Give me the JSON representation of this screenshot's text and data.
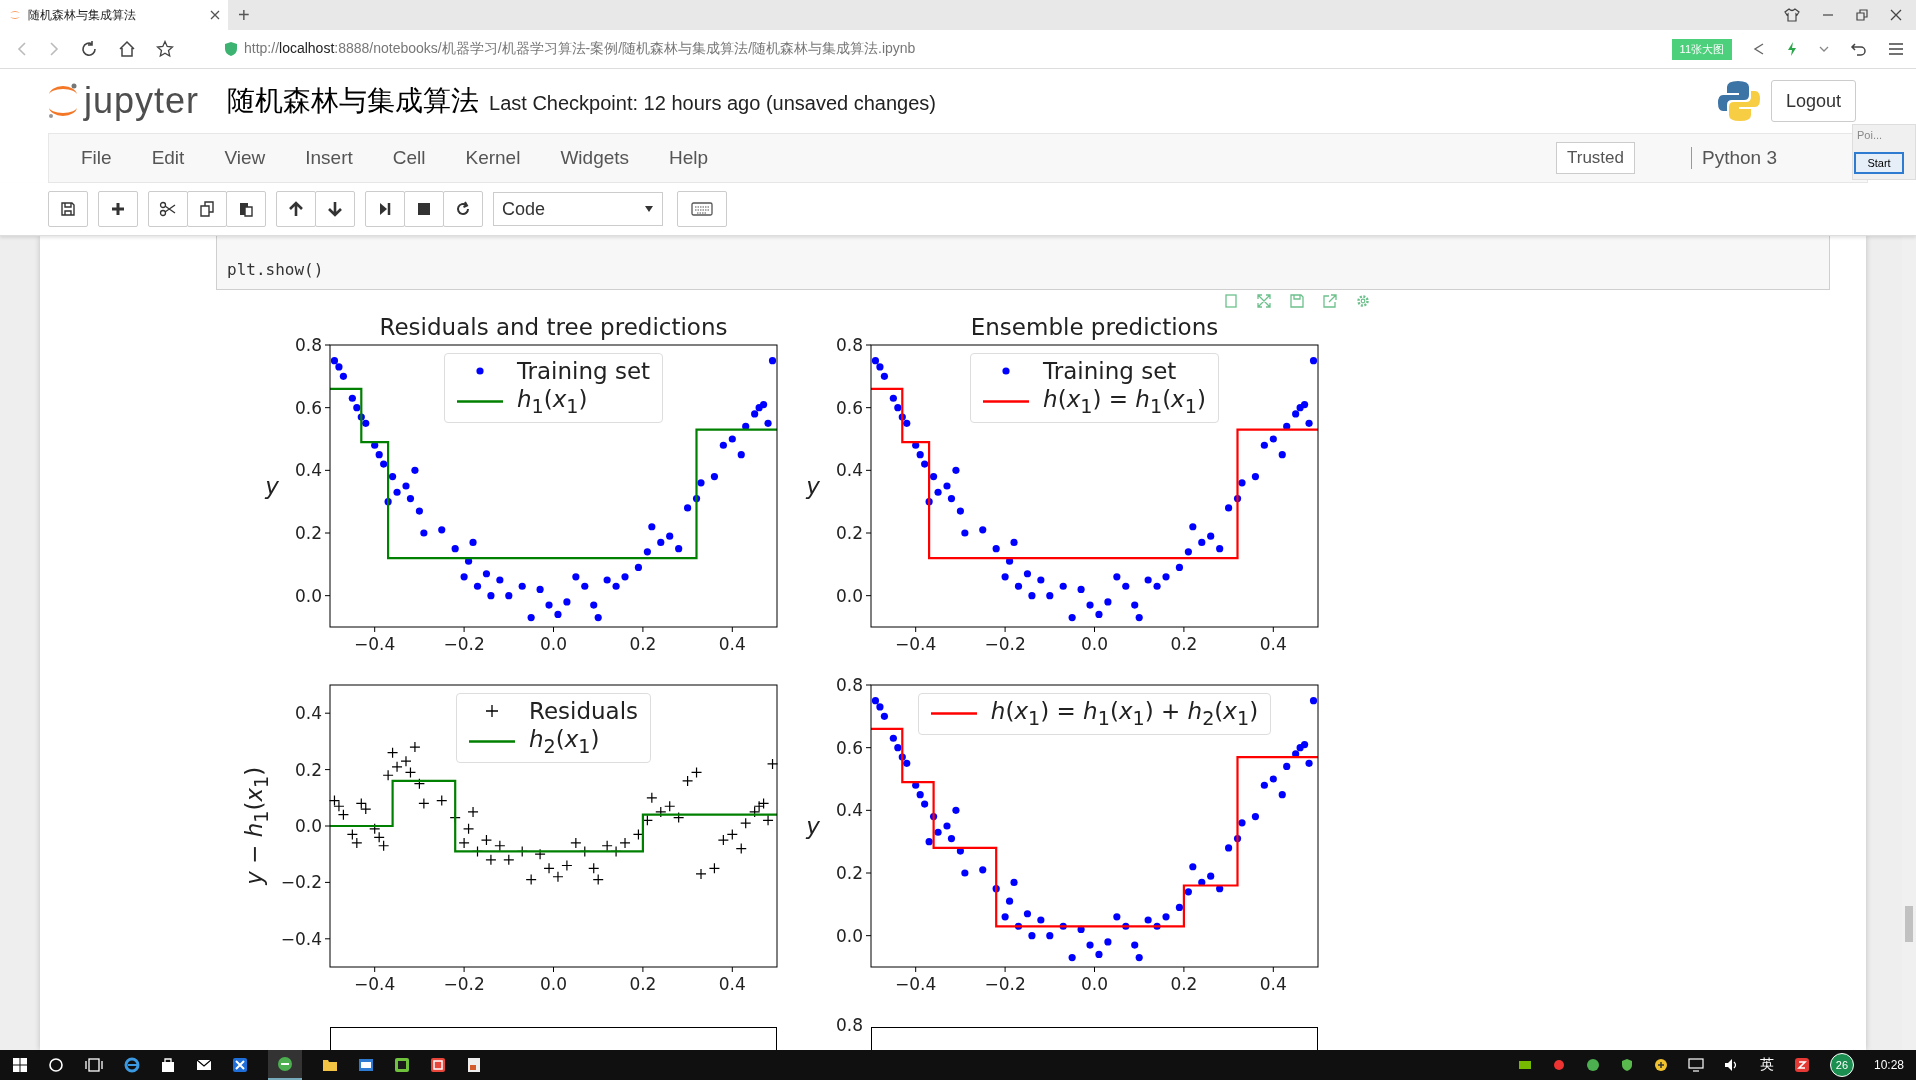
{
  "browser": {
    "tab_title": "随机森林与集成算法",
    "new_tab": "+",
    "url": "http://**localhost**:8888/notebooks/机器学习/机器学习算法-案例/随机森林与集成算法/随机森林与集成算法.ipynb",
    "badge": "11张大图"
  },
  "notebook": {
    "logo_text": "jupyter",
    "title": "随机森林与集成算法",
    "checkpoint": "Last Checkpoint: 12 hours ago (unsaved changes)",
    "logout": "Logout"
  },
  "menu": [
    "File",
    "Edit",
    "View",
    "Insert",
    "Cell",
    "Kernel",
    "Widgets",
    "Help"
  ],
  "trusted": "Trusted",
  "kernel": "Python 3",
  "toolbar": {
    "cell_type": "Code"
  },
  "popup": {
    "title": "Poi...",
    "button": "Start"
  },
  "cell": {
    "code": "plt.show()"
  },
  "charts": [
    {
      "chart_data": {
        "type": "scatter",
        "title": "Residuals and tree predictions",
        "ylabel": "*y*",
        "legend": true,
        "xlim": [
          -0.5,
          0.5
        ],
        "ylim": [
          -0.1,
          0.8
        ],
        "xticks": [
          {
            "value": -0.4,
            "label": "−0.4"
          },
          {
            "value": -0.2,
            "label": "−0.2"
          },
          {
            "value": 0,
            "label": "0.0"
          },
          {
            "value": 0.2,
            "label": "0.2"
          },
          {
            "value": 0.4,
            "label": "0.4"
          }
        ],
        "yticks": [
          {
            "value": 0.8,
            "label": "0.8"
          },
          {
            "value": 0.6,
            "label": "0.6"
          },
          {
            "value": 0.4,
            "label": "0.4"
          },
          {
            "value": 0.2,
            "label": "0.2"
          },
          {
            "value": 0,
            "label": "0.0"
          }
        ],
        "series": [
          {
            "name": "Training set",
            "type": "scatter",
            "marker": "circle",
            "color": "#0000ff",
            "x": [
              -0.49,
              -0.48,
              -0.47,
              -0.45,
              -0.44,
              -0.43,
              -0.42,
              -0.4,
              -0.39,
              -0.38,
              -0.37,
              -0.36,
              -0.35,
              -0.33,
              -0.32,
              -0.31,
              -0.3,
              -0.29,
              -0.25,
              -0.22,
              -0.2,
              -0.19,
              -0.18,
              -0.17,
              -0.15,
              -0.14,
              -0.12,
              -0.1,
              -0.07,
              -0.05,
              -0.03,
              -0.01,
              0.01,
              0.03,
              0.05,
              0.07,
              0.09,
              0.1,
              0.12,
              0.14,
              0.16,
              0.19,
              0.21,
              0.22,
              0.24,
              0.26,
              0.28,
              0.3,
              0.32,
              0.33,
              0.36,
              0.38,
              0.4,
              0.42,
              0.43,
              0.45,
              0.46,
              0.47,
              0.48,
              0.49
            ],
            "values": [
              0.75,
              0.73,
              0.7,
              0.63,
              0.6,
              0.57,
              0.55,
              0.48,
              0.45,
              0.42,
              0.3,
              0.38,
              0.33,
              0.35,
              0.31,
              0.4,
              0.27,
              0.2,
              0.21,
              0.15,
              0.06,
              0.11,
              0.17,
              0.03,
              0.07,
              0.0,
              0.05,
              0.0,
              0.03,
              -0.07,
              0.02,
              -0.03,
              -0.06,
              -0.02,
              0.06,
              0.03,
              -0.03,
              -0.07,
              0.05,
              0.03,
              0.06,
              0.09,
              0.14,
              0.22,
              0.17,
              0.19,
              0.15,
              0.28,
              0.31,
              0.36,
              0.38,
              0.48,
              0.5,
              0.45,
              0.54,
              0.58,
              0.6,
              0.61,
              0.55,
              0.75
            ]
          },
          {
            "name": "*h*$_{1}$(*x*$_{1}$)",
            "type": "line",
            "color": "#008000",
            "x": [
              -0.5,
              -0.43,
              -0.43,
              -0.37,
              -0.37,
              0.32,
              0.32,
              0.5
            ],
            "values": [
              0.66,
              0.66,
              0.49,
              0.49,
              0.12,
              0.12,
              0.53,
              0.53
            ]
          }
        ]
      }
    },
    {
      "chart_data": {
        "type": "scatter",
        "title": "Ensemble predictions",
        "ylabel": "*y*",
        "legend": true,
        "xlim": [
          -0.5,
          0.5
        ],
        "ylim": [
          -0.1,
          0.8
        ],
        "xticks": [
          {
            "value": -0.4,
            "label": "−0.4"
          },
          {
            "value": -0.2,
            "label": "−0.2"
          },
          {
            "value": 0,
            "label": "0.0"
          },
          {
            "value": 0.2,
            "label": "0.2"
          },
          {
            "value": 0.4,
            "label": "0.4"
          }
        ],
        "yticks": [
          {
            "value": 0.8,
            "label": "0.8"
          },
          {
            "value": 0.6,
            "label": "0.6"
          },
          {
            "value": 0.4,
            "label": "0.4"
          },
          {
            "value": 0.2,
            "label": "0.2"
          },
          {
            "value": 0,
            "label": "0.0"
          }
        ],
        "series": [
          {
            "name": "Training set",
            "type": "scatter",
            "marker": "circle",
            "color": "#0000ff",
            "x": [
              -0.49,
              -0.48,
              -0.47,
              -0.45,
              -0.44,
              -0.43,
              -0.42,
              -0.4,
              -0.39,
              -0.38,
              -0.37,
              -0.36,
              -0.35,
              -0.33,
              -0.32,
              -0.31,
              -0.3,
              -0.29,
              -0.25,
              -0.22,
              -0.2,
              -0.19,
              -0.18,
              -0.17,
              -0.15,
              -0.14,
              -0.12,
              -0.1,
              -0.07,
              -0.05,
              -0.03,
              -0.01,
              0.01,
              0.03,
              0.05,
              0.07,
              0.09,
              0.1,
              0.12,
              0.14,
              0.16,
              0.19,
              0.21,
              0.22,
              0.24,
              0.26,
              0.28,
              0.3,
              0.32,
              0.33,
              0.36,
              0.38,
              0.4,
              0.42,
              0.43,
              0.45,
              0.46,
              0.47,
              0.48,
              0.49
            ],
            "values": [
              0.75,
              0.73,
              0.7,
              0.63,
              0.6,
              0.57,
              0.55,
              0.48,
              0.45,
              0.42,
              0.3,
              0.38,
              0.33,
              0.35,
              0.31,
              0.4,
              0.27,
              0.2,
              0.21,
              0.15,
              0.06,
              0.11,
              0.17,
              0.03,
              0.07,
              0.0,
              0.05,
              0.0,
              0.03,
              -0.07,
              0.02,
              -0.03,
              -0.06,
              -0.02,
              0.06,
              0.03,
              -0.03,
              -0.07,
              0.05,
              0.03,
              0.06,
              0.09,
              0.14,
              0.22,
              0.17,
              0.19,
              0.15,
              0.28,
              0.31,
              0.36,
              0.38,
              0.48,
              0.5,
              0.45,
              0.54,
              0.58,
              0.6,
              0.61,
              0.55,
              0.75
            ]
          },
          {
            "name": "*h*(*x*$_{1}$) = *h*$_{1}$(*x*$_{1}$)",
            "type": "line",
            "color": "#ff0000",
            "x": [
              -0.5,
              -0.43,
              -0.43,
              -0.37,
              -0.37,
              0.32,
              0.32,
              0.5
            ],
            "values": [
              0.66,
              0.66,
              0.49,
              0.49,
              0.12,
              0.12,
              0.53,
              0.53
            ]
          }
        ]
      }
    },
    {
      "chart_data": {
        "type": "scatter",
        "ylabel": "*y* − *h*$_{1}$(*x*$_{1}$)",
        "legend": true,
        "xlim": [
          -0.5,
          0.5
        ],
        "ylim": [
          -0.5,
          0.5
        ],
        "xticks": [
          {
            "value": -0.4,
            "label": "−0.4"
          },
          {
            "value": -0.2,
            "label": "−0.2"
          },
          {
            "value": 0,
            "label": "0.0"
          },
          {
            "value": 0.2,
            "label": "0.2"
          },
          {
            "value": 0.4,
            "label": "0.4"
          }
        ],
        "yticks": [
          {
            "value": 0.4,
            "label": "0.4"
          },
          {
            "value": 0.2,
            "label": "0.2"
          },
          {
            "value": 0,
            "label": "0.0"
          },
          {
            "value": -0.2,
            "label": "−0.2"
          },
          {
            "value": -0.4,
            "label": "−0.4"
          }
        ],
        "series": [
          {
            "name": "Residuals",
            "type": "scatter",
            "marker": "cross",
            "color": "#000000",
            "x": [
              -0.49,
              -0.48,
              -0.47,
              -0.45,
              -0.44,
              -0.43,
              -0.42,
              -0.4,
              -0.39,
              -0.38,
              -0.37,
              -0.36,
              -0.35,
              -0.33,
              -0.32,
              -0.31,
              -0.3,
              -0.29,
              -0.25,
              -0.22,
              -0.2,
              -0.19,
              -0.18,
              -0.17,
              -0.15,
              -0.14,
              -0.12,
              -0.1,
              -0.07,
              -0.05,
              -0.03,
              -0.01,
              0.01,
              0.03,
              0.05,
              0.07,
              0.09,
              0.1,
              0.12,
              0.14,
              0.16,
              0.19,
              0.21,
              0.22,
              0.24,
              0.26,
              0.28,
              0.3,
              0.32,
              0.33,
              0.36,
              0.38,
              0.4,
              0.42,
              0.43,
              0.45,
              0.46,
              0.47,
              0.48,
              0.49
            ],
            "values": [
              0.09,
              0.07,
              0.04,
              -0.03,
              -0.06,
              0.08,
              0.06,
              -0.01,
              -0.04,
              -0.07,
              0.18,
              0.26,
              0.21,
              0.23,
              0.19,
              0.28,
              0.15,
              0.08,
              0.09,
              0.03,
              -0.06,
              -0.01,
              0.05,
              -0.09,
              -0.05,
              -0.12,
              -0.07,
              -0.12,
              -0.09,
              -0.19,
              -0.1,
              -0.15,
              -0.18,
              -0.14,
              -0.06,
              -0.09,
              -0.15,
              -0.19,
              -0.07,
              -0.09,
              -0.06,
              -0.03,
              0.02,
              0.1,
              0.05,
              0.07,
              0.03,
              0.16,
              0.19,
              -0.17,
              -0.15,
              -0.05,
              -0.03,
              -0.08,
              0.01,
              0.05,
              0.07,
              0.08,
              0.02,
              0.22
            ]
          },
          {
            "name": "*h*$_{2}$(*x*$_{1}$)",
            "type": "line",
            "color": "#008000",
            "x": [
              -0.5,
              -0.36,
              -0.36,
              -0.22,
              -0.22,
              0.2,
              0.2,
              0.5
            ],
            "values": [
              0,
              0,
              0.16,
              0.16,
              -0.09,
              -0.09,
              0.04,
              0.04
            ]
          }
        ]
      }
    },
    {
      "chart_data": {
        "type": "scatter",
        "ylabel": "*y*",
        "legend": true,
        "xlim": [
          -0.5,
          0.5
        ],
        "ylim": [
          -0.1,
          0.8
        ],
        "xticks": [
          {
            "value": -0.4,
            "label": "−0.4"
          },
          {
            "value": -0.2,
            "label": "−0.2"
          },
          {
            "value": 0,
            "label": "0.0"
          },
          {
            "value": 0.2,
            "label": "0.2"
          },
          {
            "value": 0.4,
            "label": "0.4"
          }
        ],
        "yticks": [
          {
            "value": 0.8,
            "label": "0.8"
          },
          {
            "value": 0.6,
            "label": "0.6"
          },
          {
            "value": 0.4,
            "label": "0.4"
          },
          {
            "value": 0.2,
            "label": "0.2"
          },
          {
            "value": 0,
            "label": "0.0"
          }
        ],
        "series": [
          {
            "type": "scatter",
            "marker": "circle",
            "color": "#0000ff",
            "x": [
              -0.49,
              -0.48,
              -0.47,
              -0.45,
              -0.44,
              -0.43,
              -0.42,
              -0.4,
              -0.39,
              -0.38,
              -0.37,
              -0.36,
              -0.35,
              -0.33,
              -0.32,
              -0.31,
              -0.3,
              -0.29,
              -0.25,
              -0.22,
              -0.2,
              -0.19,
              -0.18,
              -0.17,
              -0.15,
              -0.14,
              -0.12,
              -0.1,
              -0.07,
              -0.05,
              -0.03,
              -0.01,
              0.01,
              0.03,
              0.05,
              0.07,
              0.09,
              0.1,
              0.12,
              0.14,
              0.16,
              0.19,
              0.21,
              0.22,
              0.24,
              0.26,
              0.28,
              0.3,
              0.32,
              0.33,
              0.36,
              0.38,
              0.4,
              0.42,
              0.43,
              0.45,
              0.46,
              0.47,
              0.48,
              0.49
            ],
            "values": [
              0.75,
              0.73,
              0.7,
              0.63,
              0.6,
              0.57,
              0.55,
              0.48,
              0.45,
              0.42,
              0.3,
              0.38,
              0.33,
              0.35,
              0.31,
              0.4,
              0.27,
              0.2,
              0.21,
              0.15,
              0.06,
              0.11,
              0.17,
              0.03,
              0.07,
              0.0,
              0.05,
              0.0,
              0.03,
              -0.07,
              0.02,
              -0.03,
              -0.06,
              -0.02,
              0.06,
              0.03,
              -0.03,
              -0.07,
              0.05,
              0.03,
              0.06,
              0.09,
              0.14,
              0.22,
              0.17,
              0.19,
              0.15,
              0.28,
              0.31,
              0.36,
              0.38,
              0.48,
              0.5,
              0.45,
              0.54,
              0.58,
              0.6,
              0.61,
              0.55,
              0.75
            ]
          },
          {
            "name": "*h*(*x*$_{1}$) = *h*$_{1}$(*x*$_{1}$) + *h*$_{2}$(*x*$_{1}$)",
            "type": "line",
            "color": "#ff0000",
            "x": [
              -0.5,
              -0.43,
              -0.43,
              -0.36,
              -0.36,
              -0.22,
              -0.22,
              0.2,
              0.2,
              0.32,
              0.32,
              0.5
            ],
            "values": [
              0.66,
              0.66,
              0.49,
              0.49,
              0.28,
              0.28,
              0.03,
              0.03,
              0.16,
              0.16,
              0.57,
              0.57
            ]
          }
        ]
      }
    }
  ],
  "next_row": {
    "tick_label": "0.8"
  },
  "taskbar": {
    "ime": "英",
    "badge": "26",
    "time": "10:28"
  }
}
